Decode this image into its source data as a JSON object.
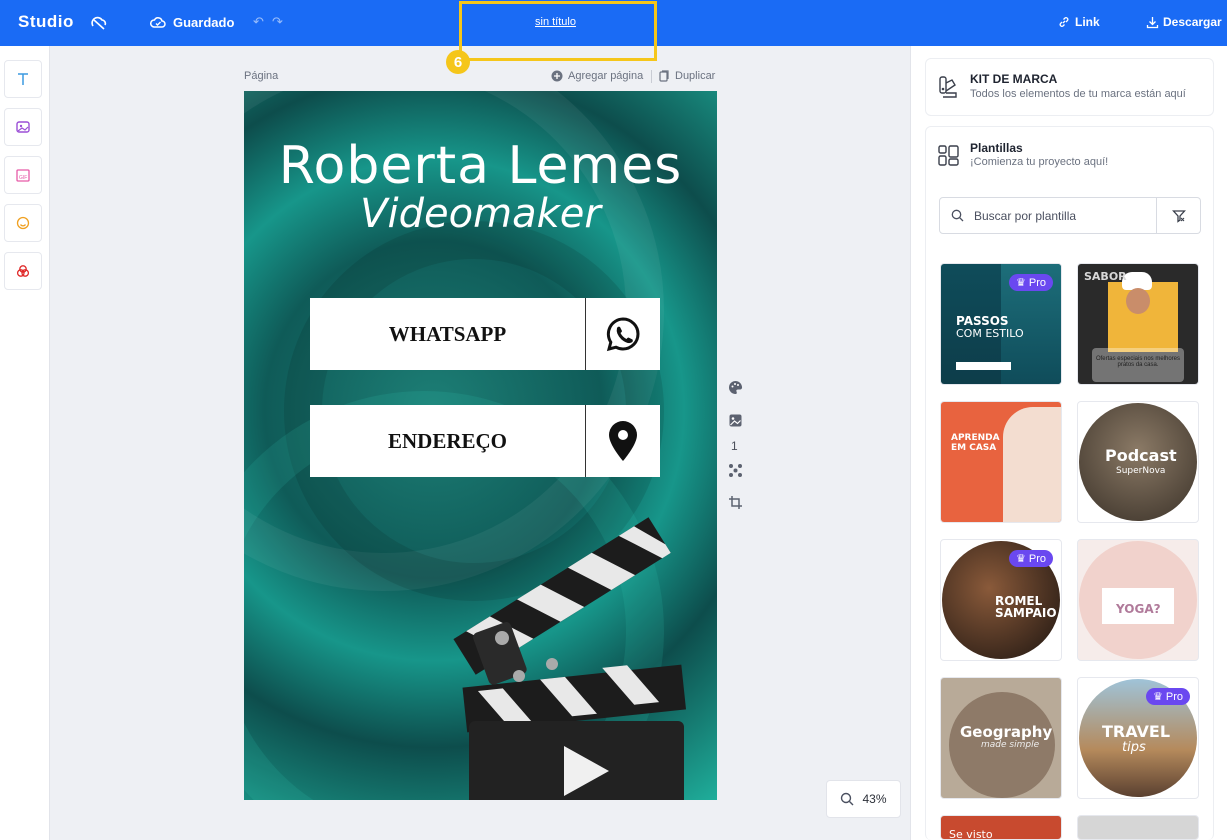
{
  "topbar": {
    "logo": "Studio",
    "saved_label": "Guardado",
    "undo_icon": "undo-icon",
    "redo_icon": "redo-icon",
    "doc_title": "sin título",
    "step_badge": "6",
    "link_label": "Link",
    "download_label": "Descargar",
    "highlight_color": "#f5c61a"
  },
  "left_tools": [
    {
      "name": "text-tool",
      "icon": "text-icon"
    },
    {
      "name": "image-tool",
      "icon": "image-upload-icon"
    },
    {
      "name": "gif-tool",
      "icon": "gif-icon"
    },
    {
      "name": "sticker-tool",
      "icon": "smiley-icon"
    },
    {
      "name": "color-tool",
      "icon": "color-circles-icon"
    }
  ],
  "canvas": {
    "page_label": "Página",
    "add_page_label": "Agregar página",
    "duplicate_label": "Duplicar",
    "page_number": "1",
    "zoom": "43%"
  },
  "design": {
    "name": "Roberta Lemes",
    "role": "Videomaker",
    "buttons": [
      {
        "label": "WHATSAPP",
        "icon": "whatsapp-icon"
      },
      {
        "label": "ENDEREÇO",
        "icon": "location-pin-icon"
      }
    ],
    "accent": "#1d7f76"
  },
  "right_panel": {
    "brand_kit_title": "KIT DE MARCA",
    "brand_kit_subtitle": "Todos los elementos de tu marca están aquí",
    "templates_title": "Plantillas",
    "templates_subtitle": "¡Comienza tu proyecto aquí!",
    "search_placeholder": "Buscar por plantilla",
    "pro_label": "Pro",
    "templates": [
      {
        "text": "PASSOS",
        "text2": "COM ESTILO",
        "pro": true
      },
      {
        "text": "SABOR",
        "text2": "Ofertas especiais nos melhores pratos da casa.",
        "pro": false
      },
      {
        "text": "APRENDA",
        "text2": "EM CASA",
        "pro": false
      },
      {
        "text": "Podcast",
        "text2": "SuperNova",
        "pro": false
      },
      {
        "text": "ROMEL",
        "text2": "SAMPAIO",
        "pro": true
      },
      {
        "text": "YOGA?",
        "text2": "",
        "pro": false
      },
      {
        "text": "Geography",
        "text2": "made simple",
        "pro": false
      },
      {
        "text": "TRAVEL",
        "text2": "tips",
        "pro": true
      },
      {
        "text": "Se visto",
        "text2": "",
        "pro": false
      },
      {
        "text": "",
        "text2": "",
        "pro": false
      }
    ]
  }
}
